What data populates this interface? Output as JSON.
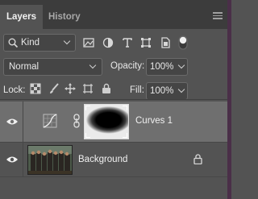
{
  "tabs": {
    "active": "Layers",
    "inactive": "History"
  },
  "filter": {
    "kind_label": "Kind"
  },
  "blend": {
    "mode": "Normal",
    "opacity_label": "Opacity:",
    "opacity_value": "100%"
  },
  "lock": {
    "lock_label": "Lock:",
    "fill_label": "Fill:",
    "fill_value": "100%"
  },
  "layers": [
    {
      "name": "Curves 1",
      "selected": true
    },
    {
      "name": "Background",
      "selected": false,
      "locked": true
    }
  ],
  "colors": {
    "panel": "#535353",
    "tabbar": "#3c3c3c",
    "selected_row": "#6f6f6f"
  }
}
